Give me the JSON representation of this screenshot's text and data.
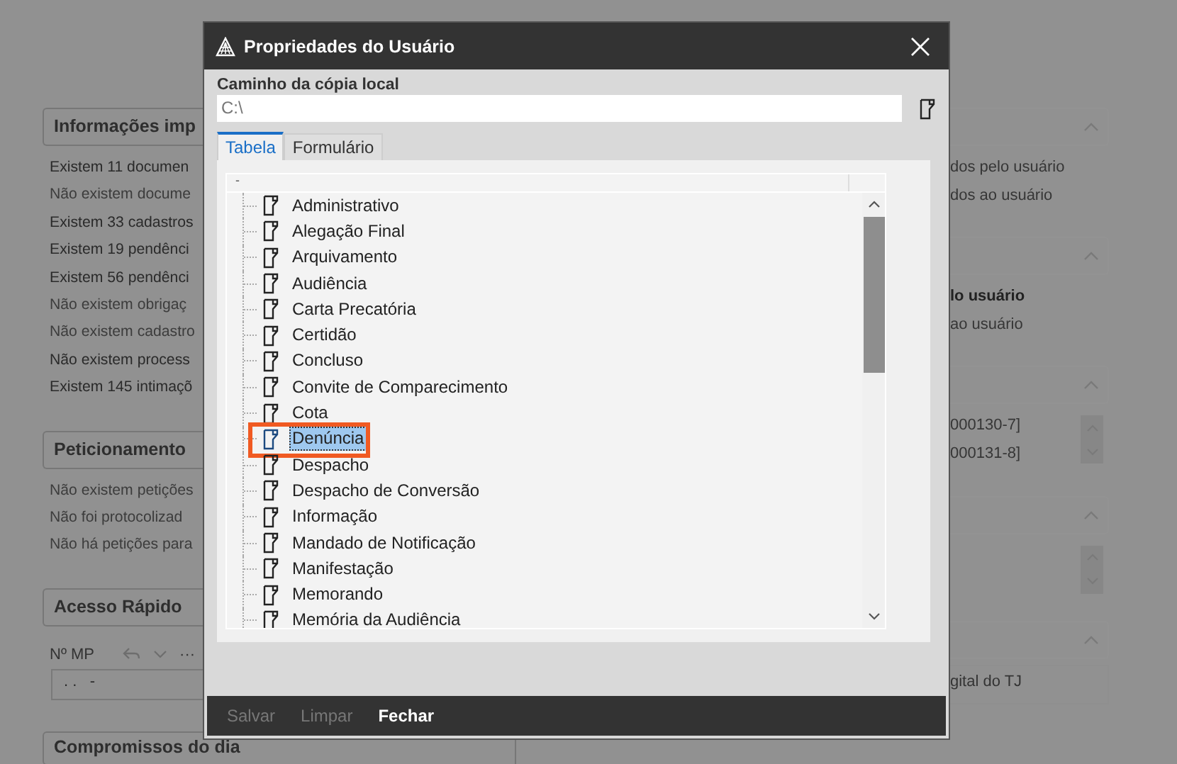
{
  "page": {
    "left_panels": [
      {
        "kind": "list",
        "title": "Informações imp",
        "lines": [
          {
            "text": "Existem 11 documen",
            "muted": false
          },
          {
            "text": "Não existem docume",
            "muted": true
          },
          {
            "text": "Existem 33 cadastros",
            "muted": false
          },
          {
            "text": "Existem 19 pendênci",
            "muted": false
          },
          {
            "text": "Existem 56 pendênci",
            "muted": false
          },
          {
            "text": "Não existem obrigaç",
            "muted": true
          },
          {
            "text": "Não existem cadastro",
            "muted": true
          },
          {
            "text": "Não existem process",
            "muted": false
          },
          {
            "text": "Existem 145 intimaçõ",
            "muted": false
          }
        ]
      },
      {
        "kind": "list",
        "title": "Peticionamento",
        "lines": [
          {
            "text": "Não existem petições",
            "muted": true
          },
          {
            "text": "Não foi protocolizad",
            "muted": true
          },
          {
            "text": "Não há petições para",
            "muted": true
          }
        ]
      },
      {
        "kind": "form",
        "title": "Acesso Rápido",
        "label": "Nº MP",
        "more": "···",
        "value": ". .   -"
      },
      {
        "kind": "list",
        "title": "Compromissos do dia"
      }
    ],
    "right_panels": [
      {
        "kind": "list",
        "lines": [
          {
            "text": "dos pelo usuário",
            "emphasis": false
          },
          {
            "text": "dos ao usuário",
            "emphasis": false
          }
        ]
      },
      {
        "kind": "list",
        "lines": [
          {
            "text": "lo usuário",
            "emphasis": true
          },
          {
            "text": "ao usuário",
            "emphasis": false
          }
        ]
      },
      {
        "kind": "scroll",
        "lines": [
          {
            "text": "000130-7]",
            "emphasis": false
          },
          {
            "text": "000131-8]",
            "emphasis": false
          }
        ]
      },
      {
        "kind": "scroll"
      },
      {
        "kind": "field",
        "value": "gital do TJ"
      }
    ]
  },
  "dialog": {
    "title": "Propriedades do Usuário",
    "path_label": "Caminho da cópia local",
    "path_value": "C:\\",
    "tabs": [
      {
        "label": "Tabela",
        "selected": true
      },
      {
        "label": "Formulário",
        "selected": false
      }
    ],
    "tree_header": "-",
    "items": [
      {
        "label": "Administrativo",
        "selected": false,
        "annotated": false
      },
      {
        "label": "Alegação Final",
        "selected": false,
        "annotated": false
      },
      {
        "label": "Arquivamento",
        "selected": false,
        "annotated": false
      },
      {
        "label": "Audiência",
        "selected": false,
        "annotated": false
      },
      {
        "label": "Carta Precatória",
        "selected": false,
        "annotated": false
      },
      {
        "label": "Certidão",
        "selected": false,
        "annotated": false
      },
      {
        "label": "Concluso",
        "selected": false,
        "annotated": false
      },
      {
        "label": "Convite de Comparecimento",
        "selected": false,
        "annotated": false
      },
      {
        "label": "Cota",
        "selected": false,
        "annotated": false
      },
      {
        "label": "Denúncia",
        "selected": true,
        "annotated": true
      },
      {
        "label": "Despacho",
        "selected": false,
        "annotated": false
      },
      {
        "label": "Despacho de Conversão",
        "selected": false,
        "annotated": false
      },
      {
        "label": "Informação",
        "selected": false,
        "annotated": false
      },
      {
        "label": "Mandado de Notificação",
        "selected": false,
        "annotated": false
      },
      {
        "label": "Manifestação",
        "selected": false,
        "annotated": false
      },
      {
        "label": "Memorando",
        "selected": false,
        "annotated": false
      },
      {
        "label": "Memória da Audiência",
        "selected": false,
        "annotated": false
      }
    ],
    "buttons": [
      {
        "label": "Salvar",
        "disabled": true
      },
      {
        "label": "Limpar",
        "disabled": true
      },
      {
        "label": "Fechar",
        "disabled": false
      }
    ]
  }
}
